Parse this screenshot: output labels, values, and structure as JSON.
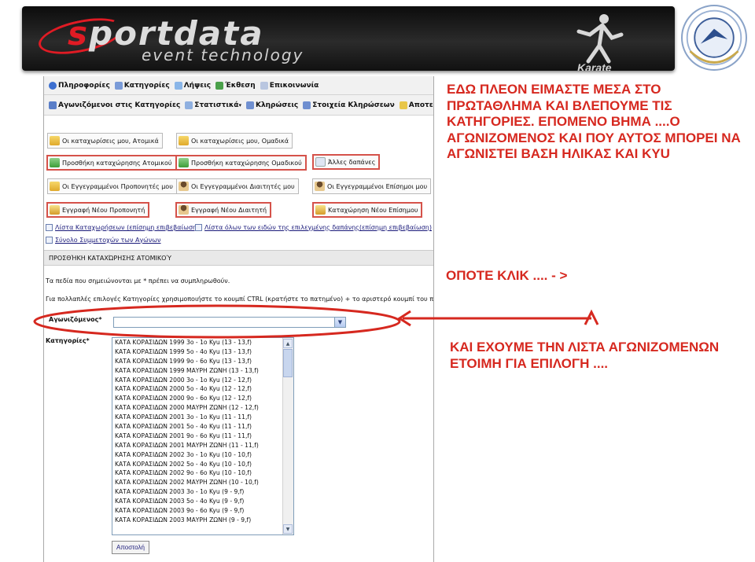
{
  "banner": {
    "logo_text_a": "s",
    "logo_text_b": "portdata",
    "logo_sub": "event technology",
    "karate_label": "Karate"
  },
  "menu": {
    "row1": [
      "Πληροφορίες",
      "Κατηγορίες",
      "Λήψεις",
      "Έκθεση",
      "Επικοινωνία"
    ],
    "row2": [
      "Αγωνιζόμενοι στις Κατηγορίες",
      "Στατιστικά",
      "Κληρώσεις",
      "Στοιχεία Κληρώσεων",
      "Αποτελέσματα"
    ]
  },
  "buttons": {
    "my_individual": "Οι καταχωρίσεις μου, Ατομικά",
    "my_team": "Οι καταχωρίσεις μου, Ομαδικά",
    "add_individual": "Προσθήκη καταχώρησης Ατομικού",
    "add_team": "Προσθήκη καταχώρησης Ομαδικού",
    "other_expenses": "Άλλες δαπάνες",
    "registered_coaches": "Οι Εγγεγραμμένοι Προπονητές μου",
    "registered_referees": "Οι Εγγεγραμμένοι Διαιτητές μου",
    "registered_officials": "Οι Εγγεγραμμένοι Επίσημοι μου",
    "new_coach": "Εγγραφή Νέου Προπονητή",
    "new_referee": "Εγγραφή Νέου Διαιτητή",
    "new_official": "Καταχώρηση Νέου Επίσημου"
  },
  "links": {
    "registrations_list": "Λίστα Καταχωρήσεων (επίσημη επιβεβαίωση)",
    "all_expenses_list": "Λίστα όλων των ειδών της επιλεγμένης δαπάνης(επίσημη επιβεβαίωση)",
    "total_participants": "Σύνολο Συμμετοχών των Αγώνων"
  },
  "form": {
    "section_title": "ΠΡΟΣΘΉΚΗ ΚΑΤΑΧΏΡΗΣΗΣ ΑΤΟΜΙΚΟΎ",
    "required_note": "Τα πεδία που σημειώνονται με * πρέπει να συμπληρωθούν.",
    "ctrl_note": "Για πολλαπλές επιλογές Κατηγορίες χρησιμοποιήστε το κουμπί CTRL (κρατήστε το πατημένο) + το αριστερό κουμπί του ποντικιού",
    "athlete_label": "Αγωνιζόμενος*",
    "athlete_value": "",
    "categories_label": "Κατηγορίες*",
    "submit_label": "Αποστολή",
    "categories": [
      "ΚΑΤΑ ΚΟΡΑΣΙΔΩΝ 1999 3ο - 1ο Kyu (13 - 13,f)",
      "ΚΑΤΑ ΚΟΡΑΣΙΔΩΝ 1999 5ο - 4ο Kyu (13 - 13,f)",
      "ΚΑΤΑ ΚΟΡΑΣΙΔΩΝ 1999 9ο - 6ο Kyu (13 - 13,f)",
      "ΚΑΤΑ ΚΟΡΑΣΙΔΩΝ 1999 ΜΑΥΡΗ ΖΩΝΗ (13 - 13,f)",
      "ΚΑΤΑ ΚΟΡΑΣΙΔΩΝ 2000 3ο - 1ο Kyu (12 - 12,f)",
      "ΚΑΤΑ ΚΟΡΑΣΙΔΩΝ 2000 5ο - 4ο Kyu (12 - 12,f)",
      "ΚΑΤΑ ΚΟΡΑΣΙΔΩΝ 2000 9ο - 6ο Kyu (12 - 12,f)",
      "ΚΑΤΑ ΚΟΡΑΣΙΔΩΝ 2000 ΜΑΥΡΗ ΖΩΝΗ (12 - 12,f)",
      "ΚΑΤΑ ΚΟΡΑΣΙΔΩΝ 2001 3ο - 1ο Kyu (11 - 11,f)",
      "ΚΑΤΑ ΚΟΡΑΣΙΔΩΝ 2001 5ο - 4ο Kyu (11 - 11,f)",
      "ΚΑΤΑ ΚΟΡΑΣΙΔΩΝ 2001 9ο - 6ο Kyu (11 - 11,f)",
      "ΚΑΤΑ ΚΟΡΑΣΙΔΩΝ 2001 ΜΑΥΡΗ ΖΩΝΗ (11 - 11,f)",
      "ΚΑΤΑ ΚΟΡΑΣΙΔΩΝ 2002 3ο - 1ο Kyu (10 - 10,f)",
      "ΚΑΤΑ ΚΟΡΑΣΙΔΩΝ 2002 5ο - 4ο Kyu (10 - 10,f)",
      "ΚΑΤΑ ΚΟΡΑΣΙΔΩΝ 2002 9ο - 6ο Kyu (10 - 10,f)",
      "ΚΑΤΑ ΚΟΡΑΣΙΔΩΝ 2002 ΜΑΥΡΗ ΖΩΝΗ (10 - 10,f)",
      "ΚΑΤΑ ΚΟΡΑΣΙΔΩΝ 2003 3ο - 1ο Kyu (9 - 9,f)",
      "ΚΑΤΑ ΚΟΡΑΣΙΔΩΝ 2003 5ο - 4ο Kyu (9 - 9,f)",
      "ΚΑΤΑ ΚΟΡΑΣΙΔΩΝ 2003 9ο - 6ο Kyu (9 - 9,f)",
      "ΚΑΤΑ ΚΟΡΑΣΙΔΩΝ 2003 ΜΑΥΡΗ ΖΩΝΗ (9 - 9,f)"
    ]
  },
  "annotations": {
    "note1": "ΕΔΩ ΠΛΕΟΝ ΕΙΜΑΣΤΕ ΜΕΣΑ ΣΤΟ ΠΡΩΤΑΘΛΗΜΑ ΚΑΙ ΒΛΕΠΟΥΜΕ ΤΙΣ ΚΑΤΗΓΟΡΙΕΣ. ΕΠΟΜΕΝΟ ΒΗΜΑ ....Ο ΑΓΩΝΙΖΟΜΕΝΟΣ ΚΑΙ ΠΟΥ ΑΥΤΟΣ ΜΠΟΡΕΙ ΝΑ ΑΓΩΝΙΣΤΕΙ ΒΑΣΗ ΗΛΙΚΑΣ ΚΑΙ KYU",
    "note2": "ΟΠΟΤΕ ΚΛΙΚ .... - >",
    "note3": "ΚΑΙ ΕΧΟΥΜΕ ΤΗΝ ΛΙΣΤΑ ΑΓΩΝΙΖΟΜΕΝΩΝ ΕΤΟΙΜΗ ΓΙΑ ΕΠΙΛΟΓΗ ...."
  },
  "colors": {
    "annotation_red": "#d6281f",
    "highlight_red": "#d5524a",
    "brand_red": "#e01b24"
  }
}
